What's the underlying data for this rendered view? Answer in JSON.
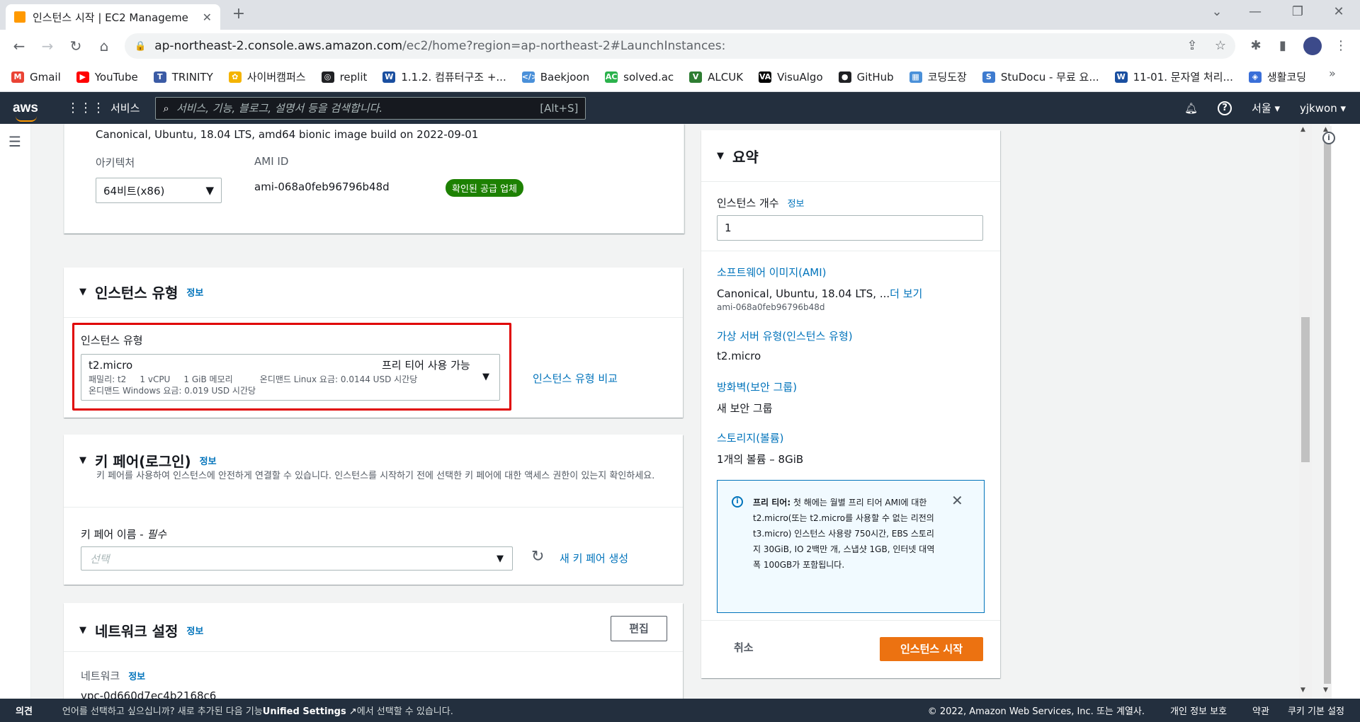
{
  "browser": {
    "tab_title": "인스턴스 시작 | EC2 Manageme",
    "url_host": "ap-northeast-2.console.aws.amazon.com",
    "url_path": "/ec2/home?region=ap-northeast-2#LaunchInstances:",
    "bookmarks": [
      {
        "label": "Gmail",
        "color": "#ea4335",
        "glyph": "M"
      },
      {
        "label": "YouTube",
        "color": "#ff0000",
        "glyph": "▶"
      },
      {
        "label": "TRINITY",
        "color": "#3b5ba5",
        "glyph": "T"
      },
      {
        "label": "사이버캠퍼스",
        "color": "#f4b400",
        "glyph": "✿"
      },
      {
        "label": "replit",
        "color": "#202124",
        "glyph": "◎"
      },
      {
        "label": "1.1.2. 컴퓨터구조 +...",
        "color": "#1a4fa0",
        "glyph": "W"
      },
      {
        "label": "Baekjoon",
        "color": "#4a90d9",
        "glyph": "&lt;/&gt;"
      },
      {
        "label": "solved.ac",
        "color": "#2bb24c",
        "glyph": "AC"
      },
      {
        "label": "ALCUK",
        "color": "#2e7d32",
        "glyph": "V"
      },
      {
        "label": "VisuAlgo",
        "color": "#000000",
        "glyph": "VA"
      },
      {
        "label": "GitHub",
        "color": "#202124",
        "glyph": "●"
      },
      {
        "label": "코딩도장",
        "color": "#4a90d9",
        "glyph": "▦"
      },
      {
        "label": "StuDocu - 무료 요...",
        "color": "#3e7bcf",
        "glyph": "S"
      },
      {
        "label": "11-01. 문자열 처리...",
        "color": "#1a4fa0",
        "glyph": "W"
      },
      {
        "label": "생활코딩",
        "color": "#3a6fd8",
        "glyph": "◈"
      }
    ],
    "bookmarks_more": "»"
  },
  "awsnav": {
    "logo": "aws",
    "services_label": "서비스",
    "search_placeholder": "서비스, 기능, 블로그, 설명서 등을 검색합니다.",
    "search_shortcut": "[Alt+S]",
    "region": "서울 ▾",
    "user": "yjkwon ▾"
  },
  "ami_section": {
    "description": "Canonical, Ubuntu, 18.04 LTS, amd64 bionic image build on 2022-09-01",
    "arch_label": "아키텍처",
    "arch_value": "64비트(x86)",
    "ami_id_label": "AMI ID",
    "ami_id_value": "ami-068a0feb96796b48d",
    "verified_badge": "확인된 공급 업체"
  },
  "instance_type": {
    "title": "인스턴스 유형",
    "info": "정보",
    "field_label": "인스턴스 유형",
    "selected_name": "t2.micro",
    "free_tier": "프리 티어 사용 가능",
    "detail_line1": "패밀리: t2     1 vCPU     1 GiB 메모리          온디맨드 Linux 요금: 0.0144 USD 시간당",
    "detail_line2": "온디맨드 Windows 요금: 0.019 USD 시간당",
    "compare_link": "인스턴스 유형 비교"
  },
  "key_pair": {
    "title": "키 페어(로그인)",
    "info": "정보",
    "description": "키 페어를 사용하여 인스턴스에 안전하게 연결할 수 있습니다. 인스턴스를 시작하기 전에 선택한 키 페어에 대한 액세스 권한이 있는지 확인하세요.",
    "field_label": "키 페어 이름 - ",
    "required": "필수",
    "select_placeholder": "선택",
    "create_link": "새 키 페어 생성"
  },
  "network": {
    "title": "네트워크 설정",
    "info": "정보",
    "edit_button": "편집",
    "network_label": "네트워크",
    "network_info": "정보",
    "vpc_value": "vpc-0d660d7ec4b2168c6"
  },
  "summary": {
    "title": "요약",
    "count_label": "인스턴스 개수",
    "count_info": "정보",
    "count_value": "1",
    "ami_link": "소프트웨어 이미지(AMI)",
    "ami_value": "Canonical, Ubuntu, 18.04 LTS, ...",
    "ami_more": "더 보기",
    "ami_id": "ami-068a0feb96796b48d",
    "type_link": "가상 서버 유형(인스턴스 유형)",
    "type_value": "t2.micro",
    "fw_link": "방화벽(보안 그룹)",
    "fw_value": "새 보안 그룹",
    "storage_link": "스토리지(볼륨)",
    "storage_value": "1개의 볼륨 – 8GiB",
    "free_tier_bold": "프리 티어:",
    "free_tier_text": " 첫 해에는 월별 프리 티어 AMI에 대한 t2.micro(또는 t2.micro를 사용할 수 없는 리전의 t3.micro) 인스턴스 사용량 750시간, EBS 스토리지 30GiB, IO 2백만 개, 스냅샷 1GB, 인터넷 대역폭 100GB가 포함됩니다.",
    "cancel": "취소",
    "launch": "인스턴스 시작"
  },
  "footer": {
    "feedback": "의견",
    "lang_text": "언어를 선택하고 싶으십니까? 새로 추가된 다음 기능",
    "unified": "Unified Settings",
    "lang_text2": "에서 선택할 수 있습니다.",
    "copyright": "© 2022, Amazon Web Services, Inc. 또는 계열사.",
    "privacy": "개인 정보 보호",
    "terms": "약관",
    "cookies": "쿠키 기본 설정"
  },
  "colors": {
    "aws_nav": "#232f3e",
    "accent_orange": "#ec7211",
    "link_blue": "#0073bb",
    "highlight_red": "#e00000",
    "badge_green": "#1d8102"
  }
}
